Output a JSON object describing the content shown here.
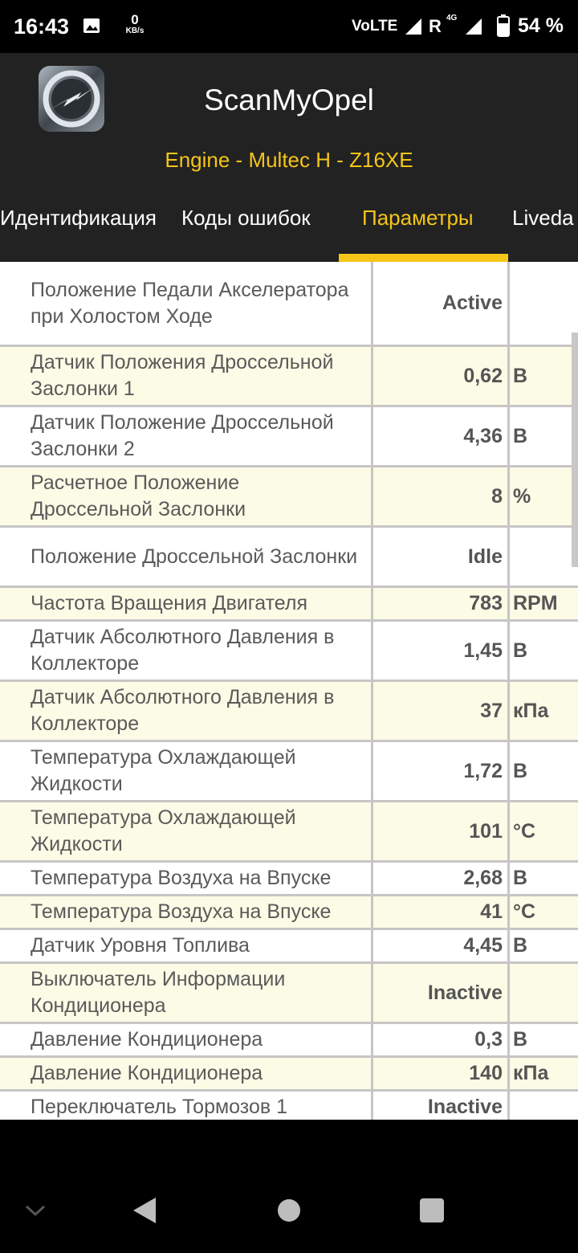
{
  "status": {
    "time": "16:43",
    "net_speed": "0",
    "net_unit": "KB/s",
    "volte": "VoLTE",
    "roaming": "R",
    "net_type": "4G",
    "battery": "54 %"
  },
  "app": {
    "title": "ScanMyOpel",
    "subtitle": "Engine - Multec H - Z16XE"
  },
  "tabs": [
    "Идентификация",
    "Коды ошибок",
    "Параметры",
    "Liveda"
  ],
  "rows": [
    {
      "name": "Положение Педали Акселератора при Холостом Ходе",
      "value": "Active",
      "unit": ""
    },
    {
      "name": "Датчик Положения Дроссельной Заслонки 1",
      "value": "0,62",
      "unit": "В"
    },
    {
      "name": "Датчик Положение Дроссельной Заслонки 2",
      "value": "4,36",
      "unit": "В"
    },
    {
      "name": "Расчетное Положение Дроссельной Заслонки",
      "value": "8",
      "unit": "%"
    },
    {
      "name": "Положение Дроссельной Заслонки",
      "value": "Idle",
      "unit": ""
    },
    {
      "name": "Частота Вращения Двигателя",
      "value": "783",
      "unit": "RPM"
    },
    {
      "name": "Датчик Абсолютного Давления в Коллекторе",
      "value": "1,45",
      "unit": "В"
    },
    {
      "name": "Датчик Абсолютного Давления в Коллекторе",
      "value": "37",
      "unit": "кПа"
    },
    {
      "name": "Температура Охлаждающей Жидкости",
      "value": "1,72",
      "unit": "В"
    },
    {
      "name": "Температура Охлаждающей Жидкости",
      "value": "101",
      "unit": "°C"
    },
    {
      "name": "Температура Воздуха на Впуске",
      "value": "2,68",
      "unit": "В"
    },
    {
      "name": "Температура Воздуха на Впуске",
      "value": "41",
      "unit": "°C"
    },
    {
      "name": "Датчик Уровня Топлива",
      "value": "4,45",
      "unit": "В"
    },
    {
      "name": "Выключатель Информации Кондиционера",
      "value": "Inactive",
      "unit": ""
    },
    {
      "name": "Давление Кондиционера",
      "value": "0,3",
      "unit": "В"
    },
    {
      "name": "Давление Кондиционера",
      "value": "140",
      "unit": "кПа"
    },
    {
      "name": "Переключатель Тормозов 1",
      "value": "Inactive",
      "unit": ""
    }
  ],
  "colors": {
    "accent": "#f5c518",
    "header_bg": "#222222",
    "row_alt": "#fbfbe6"
  }
}
